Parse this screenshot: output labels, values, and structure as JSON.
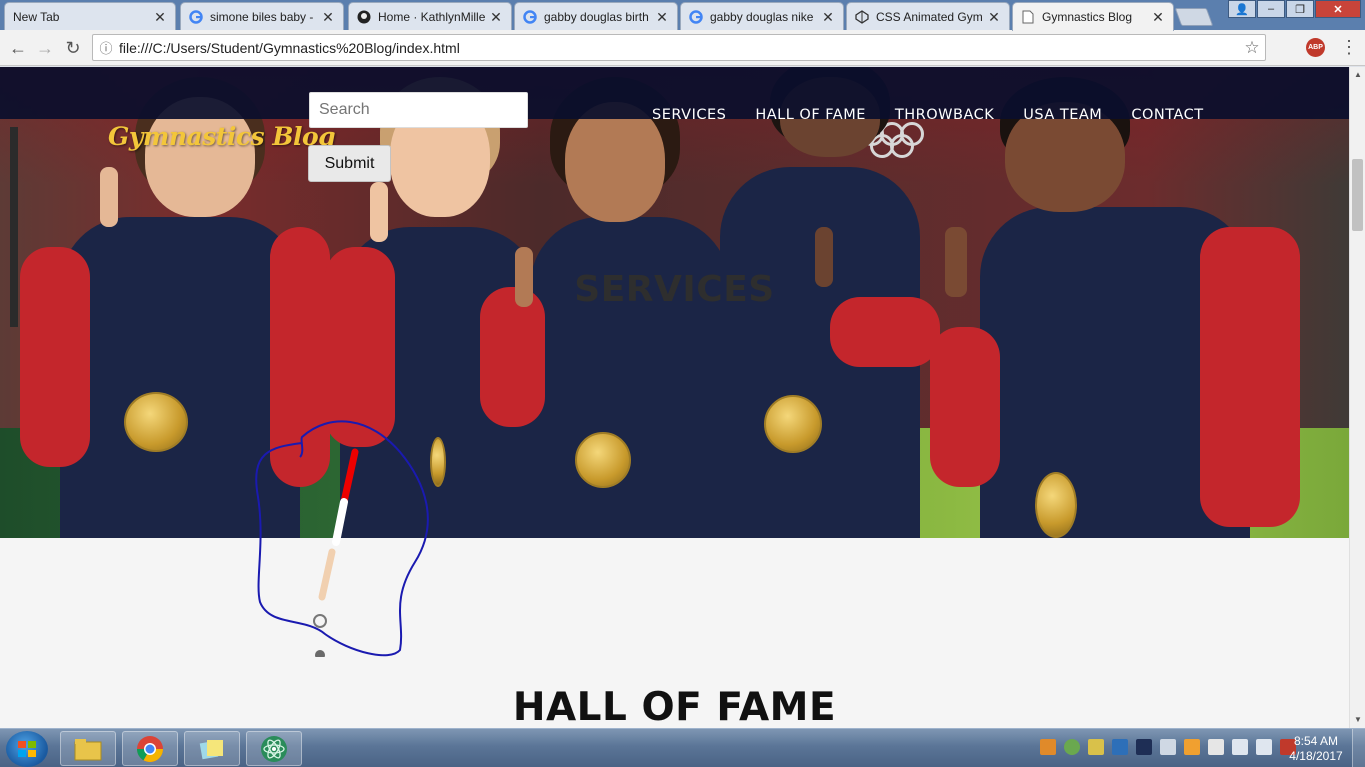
{
  "browser": {
    "tabs": [
      {
        "title": "New Tab",
        "icon": "blank-tab-icon",
        "active": false
      },
      {
        "title": "simone biles baby -",
        "icon": "google-icon",
        "active": false
      },
      {
        "title": "Home · KathlynMille",
        "icon": "github-icon",
        "active": false
      },
      {
        "title": "gabby douglas birth",
        "icon": "google-icon",
        "active": false
      },
      {
        "title": "gabby douglas nike",
        "icon": "google-icon",
        "active": false
      },
      {
        "title": "CSS Animated Gym",
        "icon": "codepen-icon",
        "active": false
      },
      {
        "title": "Gymnastics Blog",
        "icon": "page-icon",
        "active": true
      }
    ],
    "address": "file:///C:/Users/Student/Gymnastics%20Blog/index.html",
    "extension_badge": "ABP"
  },
  "page": {
    "brand": "Gymnastics Blog",
    "search": {
      "placeholder": "Search",
      "value": ""
    },
    "submit_label": "Submit",
    "nav": [
      "SERVICES",
      "HALL OF FAME",
      "THROWBACK",
      "USA TEAM",
      "CONTACT"
    ],
    "services_heading": "SERVICES",
    "hall_of_fame_heading": "HALL OF FAME"
  },
  "taskbar": {
    "time": "8:54 AM",
    "date": "4/18/2017",
    "pinned": [
      "explorer-icon",
      "chrome-icon",
      "sticky-notes-icon",
      "atom-icon"
    ]
  },
  "colors": {
    "brand": "#f3c63a",
    "nav_bar": "#0a0e2d",
    "annotation": "#1a1ab0"
  }
}
